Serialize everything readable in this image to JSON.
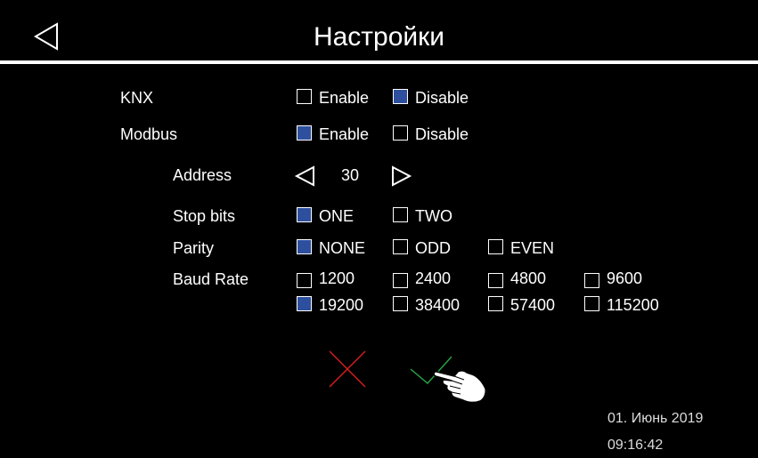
{
  "header": {
    "title": "Настройки",
    "back_icon": "back-triangle-icon"
  },
  "knx": {
    "label": "KNX",
    "options": [
      {
        "label": "Enable",
        "checked": false
      },
      {
        "label": "Disable",
        "checked": true
      }
    ]
  },
  "modbus": {
    "label": "Modbus",
    "options": [
      {
        "label": "Enable",
        "checked": true
      },
      {
        "label": "Disable",
        "checked": false
      }
    ],
    "address": {
      "label": "Address",
      "value": "30"
    },
    "stop_bits": {
      "label": "Stop bits",
      "options": [
        {
          "label": "ONE",
          "checked": true
        },
        {
          "label": "TWO",
          "checked": false
        }
      ]
    },
    "parity": {
      "label": "Parity",
      "options": [
        {
          "label": "NONE",
          "checked": true
        },
        {
          "label": "ODD",
          "checked": false
        },
        {
          "label": "EVEN",
          "checked": false
        }
      ]
    },
    "baud_rate": {
      "label": "Baud Rate",
      "options": [
        {
          "label": "1200",
          "checked": false
        },
        {
          "label": "2400",
          "checked": false
        },
        {
          "label": "4800",
          "checked": false
        },
        {
          "label": "9600",
          "checked": false
        },
        {
          "label": "19200",
          "checked": true
        },
        {
          "label": "38400",
          "checked": false
        },
        {
          "label": "57400",
          "checked": false
        },
        {
          "label": "115200",
          "checked": false
        }
      ]
    }
  },
  "actions": {
    "cancel_icon": "cancel-x-icon",
    "confirm_icon": "confirm-check-icon"
  },
  "footer": {
    "date": "01. Июнь 2019",
    "time": "09:16:42"
  },
  "colors": {
    "background": "#000000",
    "text": "#ffffff",
    "checked_fill": "#2d4f9e",
    "cancel": "#d81e1e",
    "confirm": "#27a844"
  }
}
